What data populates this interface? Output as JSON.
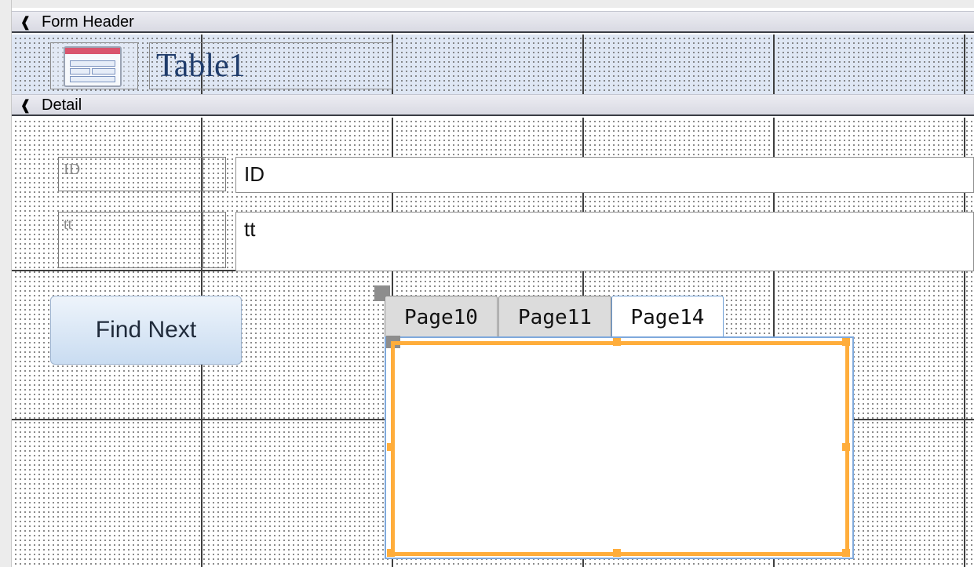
{
  "sections": {
    "form_header": {
      "label": "Form Header",
      "arrow_icon": "collapse-arrow-icon"
    },
    "detail": {
      "label": "Detail",
      "arrow_icon": "collapse-arrow-icon"
    }
  },
  "header": {
    "title": "Table1",
    "icon": "form-logo-icon"
  },
  "fields": [
    {
      "label": "ID",
      "value": "ID"
    },
    {
      "label": "tt",
      "value": "tt"
    }
  ],
  "button": {
    "label": "Find Next"
  },
  "tabs": [
    {
      "label": "Page10",
      "active": false
    },
    {
      "label": "Page11",
      "active": false
    },
    {
      "label": "Page14",
      "active": true
    }
  ],
  "colors": {
    "selection": "#ffad3b",
    "tab_border": "#7fa9dc",
    "title_text": "#1f3c6b"
  }
}
